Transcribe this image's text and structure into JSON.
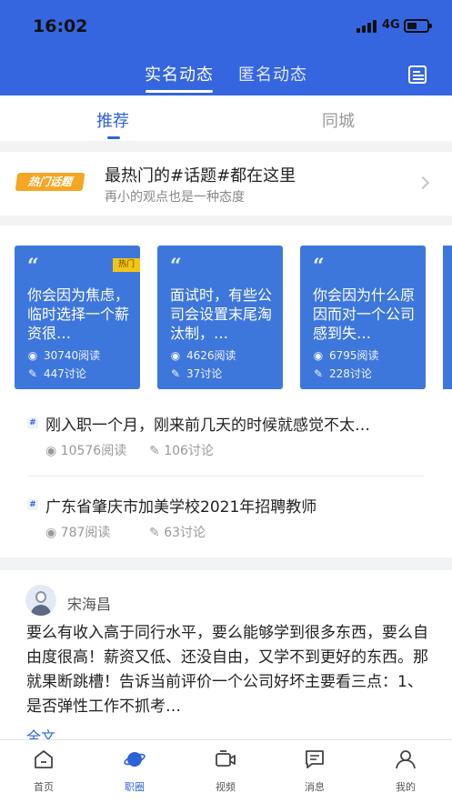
{
  "status_bar": {
    "time": "16:02",
    "network": "4G"
  },
  "header": {
    "tabs": [
      {
        "label": "实名动态",
        "active": true
      },
      {
        "label": "匿名动态",
        "active": false
      }
    ],
    "message_icon": "message-list-icon"
  },
  "subtabs": [
    {
      "label": "推荐",
      "active": true
    },
    {
      "label": "同城",
      "active": false
    }
  ],
  "hot_topics": {
    "badge": "热门话题",
    "title": "最热门的#话题#都在这里",
    "subtitle": "再小的观点也是一种态度"
  },
  "cards": [
    {
      "text": "你会因为焦虑，临时选择一个薪资很…",
      "hot_label": "热门",
      "reads": "30740阅读",
      "comments": "447讨论"
    },
    {
      "text": "面试时，有些公司会设置末尾淘汰制，…",
      "hot_label": "",
      "reads": "4626阅读",
      "comments": "37讨论"
    },
    {
      "text": "你会因为什么原因而对一个公司感到失…",
      "hot_label": "",
      "reads": "6795阅读",
      "comments": "228讨论"
    }
  ],
  "topics": [
    {
      "title": "刚入职一个月，刚来前几天的时候就感觉不太…",
      "reads": "10576阅读",
      "comments": "106讨论"
    },
    {
      "title": "广东省肇庆市加美学校2021年招聘教师",
      "reads": "787阅读",
      "comments": "63讨论"
    }
  ],
  "post": {
    "username": "宋海昌",
    "text": "要么有收入高于同行水平，要么能够学到很多东西，要么自由度很高！薪资又低、还没自由，又学不到更好的东西。那就果断跳槽！告诉当前评价一个公司好坏主要看三点：1、是否弹性工作不抓考…",
    "more_label": "全文"
  },
  "tabbar": [
    {
      "label": "首页",
      "active": false
    },
    {
      "label": "职圈",
      "active": true
    },
    {
      "label": "视频",
      "active": false
    },
    {
      "label": "消息",
      "active": false
    },
    {
      "label": "我的",
      "active": false
    }
  ],
  "colors": {
    "brand": "#3566e0",
    "accent": "#2d63d8",
    "hot": "#f5a623",
    "card": "#3e77dc"
  }
}
